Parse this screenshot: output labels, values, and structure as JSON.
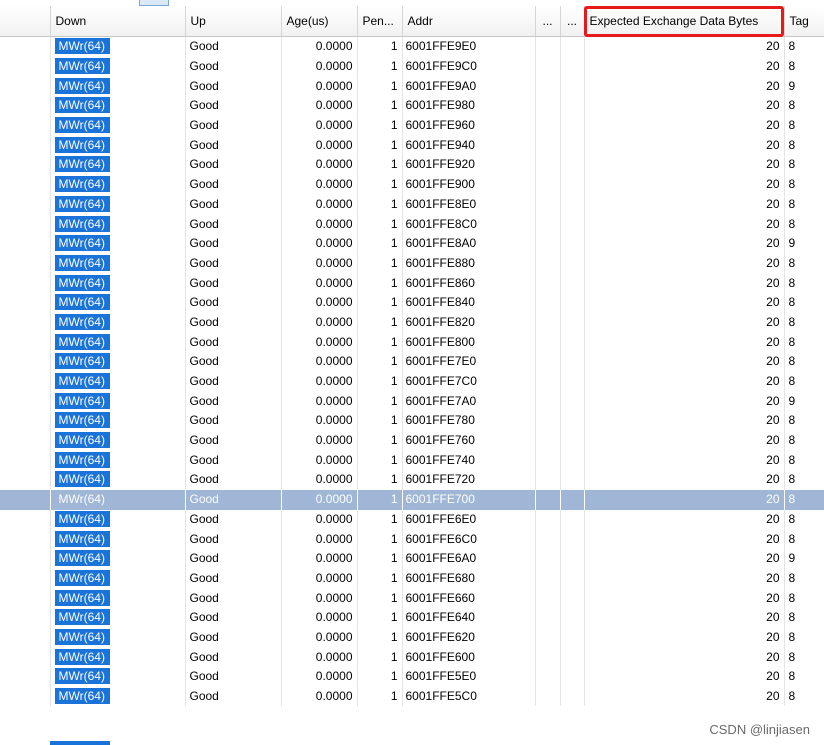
{
  "columns": [
    {
      "key": "down",
      "label": "Down"
    },
    {
      "key": "up",
      "label": "Up"
    },
    {
      "key": "age",
      "label": "Age(us)"
    },
    {
      "key": "pen",
      "label": "Pen..."
    },
    {
      "key": "addr",
      "label": "Addr"
    },
    {
      "key": "c6",
      "label": "..."
    },
    {
      "key": "c7",
      "label": "..."
    },
    {
      "key": "bytes",
      "label": "Expected Exchange Data Bytes"
    },
    {
      "key": "tag",
      "label": "Tag"
    }
  ],
  "highlighted_column": "Expected Exchange Data Bytes",
  "selected_row_index": 23,
  "rows": [
    {
      "down": "MWr(64)",
      "up": "Good",
      "age": "0.0000",
      "pen": "1",
      "addr": "6001FFE9E0",
      "bytes": "20",
      "tag": "8"
    },
    {
      "down": "MWr(64)",
      "up": "Good",
      "age": "0.0000",
      "pen": "1",
      "addr": "6001FFE9C0",
      "bytes": "20",
      "tag": "8"
    },
    {
      "down": "MWr(64)",
      "up": "Good",
      "age": "0.0000",
      "pen": "1",
      "addr": "6001FFE9A0",
      "bytes": "20",
      "tag": "9"
    },
    {
      "down": "MWr(64)",
      "up": "Good",
      "age": "0.0000",
      "pen": "1",
      "addr": "6001FFE980",
      "bytes": "20",
      "tag": "8"
    },
    {
      "down": "MWr(64)",
      "up": "Good",
      "age": "0.0000",
      "pen": "1",
      "addr": "6001FFE960",
      "bytes": "20",
      "tag": "8"
    },
    {
      "down": "MWr(64)",
      "up": "Good",
      "age": "0.0000",
      "pen": "1",
      "addr": "6001FFE940",
      "bytes": "20",
      "tag": "8"
    },
    {
      "down": "MWr(64)",
      "up": "Good",
      "age": "0.0000",
      "pen": "1",
      "addr": "6001FFE920",
      "bytes": "20",
      "tag": "8"
    },
    {
      "down": "MWr(64)",
      "up": "Good",
      "age": "0.0000",
      "pen": "1",
      "addr": "6001FFE900",
      "bytes": "20",
      "tag": "8"
    },
    {
      "down": "MWr(64)",
      "up": "Good",
      "age": "0.0000",
      "pen": "1",
      "addr": "6001FFE8E0",
      "bytes": "20",
      "tag": "8"
    },
    {
      "down": "MWr(64)",
      "up": "Good",
      "age": "0.0000",
      "pen": "1",
      "addr": "6001FFE8C0",
      "bytes": "20",
      "tag": "8"
    },
    {
      "down": "MWr(64)",
      "up": "Good",
      "age": "0.0000",
      "pen": "1",
      "addr": "6001FFE8A0",
      "bytes": "20",
      "tag": "9"
    },
    {
      "down": "MWr(64)",
      "up": "Good",
      "age": "0.0000",
      "pen": "1",
      "addr": "6001FFE880",
      "bytes": "20",
      "tag": "8"
    },
    {
      "down": "MWr(64)",
      "up": "Good",
      "age": "0.0000",
      "pen": "1",
      "addr": "6001FFE860",
      "bytes": "20",
      "tag": "8"
    },
    {
      "down": "MWr(64)",
      "up": "Good",
      "age": "0.0000",
      "pen": "1",
      "addr": "6001FFE840",
      "bytes": "20",
      "tag": "8"
    },
    {
      "down": "MWr(64)",
      "up": "Good",
      "age": "0.0000",
      "pen": "1",
      "addr": "6001FFE820",
      "bytes": "20",
      "tag": "8"
    },
    {
      "down": "MWr(64)",
      "up": "Good",
      "age": "0.0000",
      "pen": "1",
      "addr": "6001FFE800",
      "bytes": "20",
      "tag": "8"
    },
    {
      "down": "MWr(64)",
      "up": "Good",
      "age": "0.0000",
      "pen": "1",
      "addr": "6001FFE7E0",
      "bytes": "20",
      "tag": "8"
    },
    {
      "down": "MWr(64)",
      "up": "Good",
      "age": "0.0000",
      "pen": "1",
      "addr": "6001FFE7C0",
      "bytes": "20",
      "tag": "8"
    },
    {
      "down": "MWr(64)",
      "up": "Good",
      "age": "0.0000",
      "pen": "1",
      "addr": "6001FFE7A0",
      "bytes": "20",
      "tag": "9"
    },
    {
      "down": "MWr(64)",
      "up": "Good",
      "age": "0.0000",
      "pen": "1",
      "addr": "6001FFE780",
      "bytes": "20",
      "tag": "8"
    },
    {
      "down": "MWr(64)",
      "up": "Good",
      "age": "0.0000",
      "pen": "1",
      "addr": "6001FFE760",
      "bytes": "20",
      "tag": "8"
    },
    {
      "down": "MWr(64)",
      "up": "Good",
      "age": "0.0000",
      "pen": "1",
      "addr": "6001FFE740",
      "bytes": "20",
      "tag": "8"
    },
    {
      "down": "MWr(64)",
      "up": "Good",
      "age": "0.0000",
      "pen": "1",
      "addr": "6001FFE720",
      "bytes": "20",
      "tag": "8"
    },
    {
      "down": "MWr(64)",
      "up": "Good",
      "age": "0.0000",
      "pen": "1",
      "addr": "6001FFE700",
      "bytes": "20",
      "tag": "8"
    },
    {
      "down": "MWr(64)",
      "up": "Good",
      "age": "0.0000",
      "pen": "1",
      "addr": "6001FFE6E0",
      "bytes": "20",
      "tag": "8"
    },
    {
      "down": "MWr(64)",
      "up": "Good",
      "age": "0.0000",
      "pen": "1",
      "addr": "6001FFE6C0",
      "bytes": "20",
      "tag": "8"
    },
    {
      "down": "MWr(64)",
      "up": "Good",
      "age": "0.0000",
      "pen": "1",
      "addr": "6001FFE6A0",
      "bytes": "20",
      "tag": "9"
    },
    {
      "down": "MWr(64)",
      "up": "Good",
      "age": "0.0000",
      "pen": "1",
      "addr": "6001FFE680",
      "bytes": "20",
      "tag": "8"
    },
    {
      "down": "MWr(64)",
      "up": "Good",
      "age": "0.0000",
      "pen": "1",
      "addr": "6001FFE660",
      "bytes": "20",
      "tag": "8"
    },
    {
      "down": "MWr(64)",
      "up": "Good",
      "age": "0.0000",
      "pen": "1",
      "addr": "6001FFE640",
      "bytes": "20",
      "tag": "8"
    },
    {
      "down": "MWr(64)",
      "up": "Good",
      "age": "0.0000",
      "pen": "1",
      "addr": "6001FFE620",
      "bytes": "20",
      "tag": "8"
    },
    {
      "down": "MWr(64)",
      "up": "Good",
      "age": "0.0000",
      "pen": "1",
      "addr": "6001FFE600",
      "bytes": "20",
      "tag": "8"
    },
    {
      "down": "MWr(64)",
      "up": "Good",
      "age": "0.0000",
      "pen": "1",
      "addr": "6001FFE5E0",
      "bytes": "20",
      "tag": "8"
    },
    {
      "down": "MWr(64)",
      "up": "Good",
      "age": "0.0000",
      "pen": "1",
      "addr": "6001FFE5C0",
      "bytes": "20",
      "tag": "8"
    }
  ],
  "watermark": "CSDN @linjiasen"
}
